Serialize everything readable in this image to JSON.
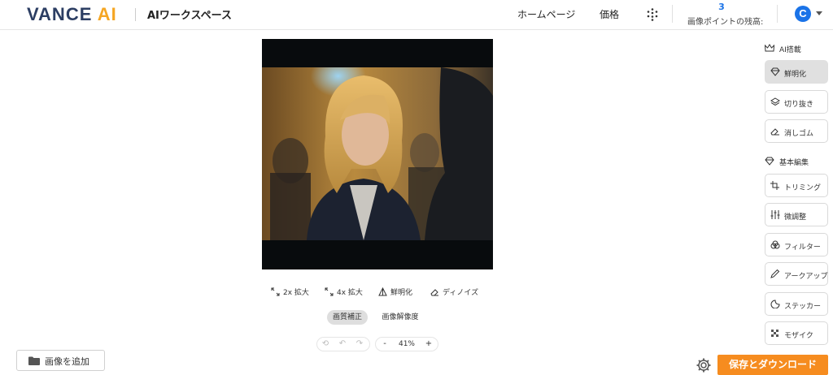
{
  "header": {
    "logo_main": "VANCE",
    "logo_accent": "AI",
    "workspace_title": "AIワークスペース",
    "nav_home": "ホームページ",
    "nav_price": "価格",
    "points_count": "3",
    "points_label": "画像ポイントの残高:",
    "avatar_initial": "C"
  },
  "toolbar": {
    "upscale_2x": "2x 拡大",
    "upscale_4x": "4x 拡大",
    "sharpen": "鮮明化",
    "denoise": "ディノイズ"
  },
  "mode_tabs": {
    "quality": "画質補正",
    "resolution": "画像解像度"
  },
  "zoom": {
    "minus": "-",
    "level": "41%",
    "plus": "+"
  },
  "add_image": "画像を追加",
  "sidebar": {
    "ai_section": "AI搭載",
    "ai_items": [
      {
        "label": "鮮明化",
        "icon": "diamond-icon"
      },
      {
        "label": "切り抜き",
        "icon": "layers-icon"
      },
      {
        "label": "消しゴム",
        "icon": "eraser-icon"
      }
    ],
    "basic_section": "基本編集",
    "basic_items": [
      {
        "label": "トリミング",
        "icon": "crop-icon"
      },
      {
        "label": "微調整",
        "icon": "sliders-icon"
      },
      {
        "label": "フィルター",
        "icon": "filter-icon"
      },
      {
        "label": "アークアップ",
        "icon": "pen-icon"
      },
      {
        "label": "ステッカー",
        "icon": "sticker-icon"
      },
      {
        "label": "モザイク",
        "icon": "mosaic-icon"
      }
    ]
  },
  "save_button": "保存とダウンロード",
  "colors": {
    "accent_orange": "#f68c1f",
    "brand_blue": "#1a73e8",
    "logo_navy": "#2c3e63"
  }
}
